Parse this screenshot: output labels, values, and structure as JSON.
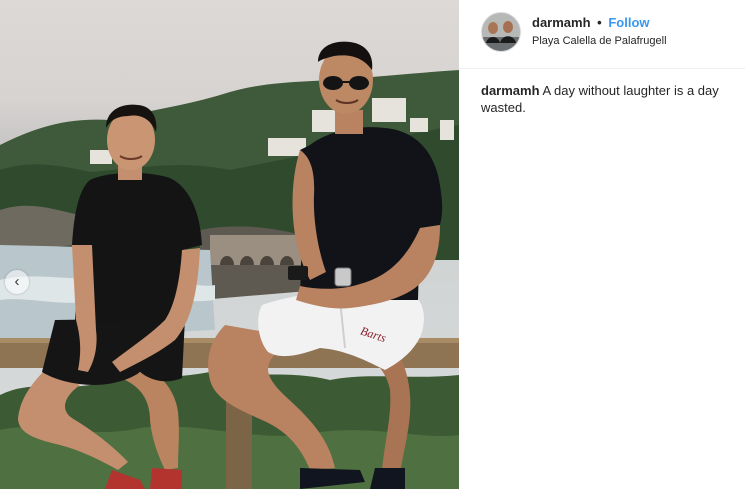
{
  "post": {
    "photo": {
      "alt_subject": "two-men-seated-on-wooden-railing",
      "prev_arrow": "‹"
    },
    "header": {
      "username": "darmamh",
      "separator": "•",
      "follow_label": "Follow",
      "location": "Playa Calella de Palafrugell"
    },
    "caption": {
      "username": "darmamh",
      "text": "A day without laughter is a day wasted."
    }
  },
  "colors": {
    "link": "#3897f0",
    "text": "#262626",
    "divider": "#efefef"
  },
  "icons": {
    "prev": "chevron-left-icon",
    "avatar": "profile-avatar"
  }
}
